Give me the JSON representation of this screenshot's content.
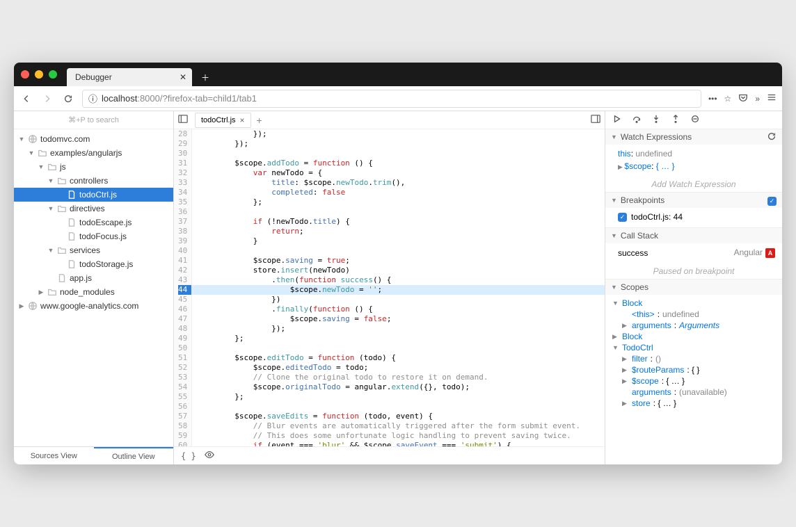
{
  "titlebar": {
    "tab_label": "Debugger"
  },
  "url": {
    "host": "localhost",
    "port": ":8000",
    "path": "/?firefox-tab=child1/tab1"
  },
  "sources": {
    "search_hint": "⌘+P to search",
    "tree": [
      {
        "label": "todomvc.com",
        "indent": 0,
        "type": "domain",
        "open": true
      },
      {
        "label": "examples/angularjs",
        "indent": 1,
        "type": "folder",
        "open": true
      },
      {
        "label": "js",
        "indent": 2,
        "type": "folder",
        "open": true
      },
      {
        "label": "controllers",
        "indent": 3,
        "type": "folder",
        "open": true
      },
      {
        "label": "todoCtrl.js",
        "indent": 4,
        "type": "file",
        "selected": true
      },
      {
        "label": "directives",
        "indent": 3,
        "type": "folder",
        "open": true
      },
      {
        "label": "todoEscape.js",
        "indent": 4,
        "type": "file"
      },
      {
        "label": "todoFocus.js",
        "indent": 4,
        "type": "file"
      },
      {
        "label": "services",
        "indent": 3,
        "type": "folder",
        "open": true
      },
      {
        "label": "todoStorage.js",
        "indent": 4,
        "type": "file"
      },
      {
        "label": "app.js",
        "indent": 3,
        "type": "file"
      },
      {
        "label": "node_modules",
        "indent": 2,
        "type": "folder",
        "open": false
      },
      {
        "label": "www.google-analytics.com",
        "indent": 0,
        "type": "domain",
        "open": false
      }
    ],
    "tabs": {
      "sources": "Sources View",
      "outline": "Outline View"
    }
  },
  "editor": {
    "tab": "todoCtrl.js",
    "footer": "{ }",
    "breakpoint_line": 44,
    "first_line": 28
  },
  "right": {
    "watch": {
      "title": "Watch Expressions",
      "rows": [
        {
          "name": "this",
          "value": "undefined"
        },
        {
          "name": "$scope",
          "value": "{ … }",
          "obj": true
        }
      ],
      "add": "Add Watch Expression"
    },
    "breakpoints": {
      "title": "Breakpoints",
      "items": [
        {
          "label": "todoCtrl.js: 44"
        }
      ]
    },
    "callstack": {
      "title": "Call Stack",
      "frames": [
        {
          "fn": "success",
          "src": "Angular"
        }
      ],
      "paused": "Paused on breakpoint"
    },
    "scopes": {
      "title": "Scopes",
      "nodes": [
        {
          "text": "Block",
          "link": true,
          "tw": "▼",
          "indent": 0
        },
        {
          "html": "<span class='obj-link'>&lt;this&gt;</span>: <span class='val-gray'>undefined</span>",
          "indent": 1
        },
        {
          "html": "<span class='obj-link'>arguments</span>: <span class='obj-link' style='font-style:italic'>Arguments</span>",
          "tw": "▶",
          "indent": 1
        },
        {
          "text": "Block",
          "link": true,
          "tw": "▶",
          "indent": 0
        },
        {
          "text": "TodoCtrl",
          "link": true,
          "tw": "▼",
          "indent": 0
        },
        {
          "html": "<span class='obj-link'>filter</span>:<span class='val-gray'>()</span>",
          "tw": "▶",
          "indent": 1
        },
        {
          "html": "<span class='obj-link'>$routeParams</span>: { }",
          "tw": "▶",
          "indent": 1
        },
        {
          "html": "<span class='obj-link'>$scope</span>: { … }",
          "tw": "▶",
          "indent": 1
        },
        {
          "html": "<span class='obj-link'>arguments</span>: <span class='val-gray'>(unavailable)</span>",
          "indent": 1
        },
        {
          "html": "<span class='obj-link'>store</span>: { … }",
          "tw": "▶",
          "indent": 1
        }
      ]
    }
  }
}
